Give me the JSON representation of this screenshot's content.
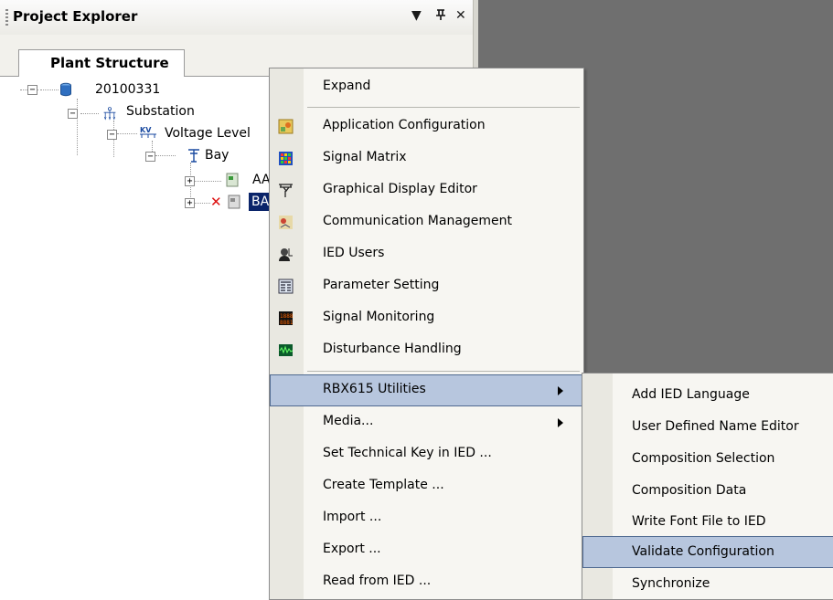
{
  "panel": {
    "title": "Project Explorer",
    "buttons": [
      "▼",
      "ᵖ",
      "✕"
    ]
  },
  "tabs": [
    {
      "label": "Plant Structure"
    }
  ],
  "tree": {
    "root": "20100331",
    "substation": "Substation",
    "voltage_level": "Voltage Level",
    "bay": "Bay",
    "ied1": "AA",
    "ied2": "BA"
  },
  "context_menu": {
    "items": [
      {
        "label": "Expand"
      },
      {
        "label": "Application Configuration",
        "icon": "application-configuration-icon"
      },
      {
        "label": "Signal Matrix",
        "icon": "signal-matrix-icon"
      },
      {
        "label": "Graphical Display Editor",
        "icon": "graphical-display-editor-icon"
      },
      {
        "label": "Communication Management",
        "icon": "communication-management-icon"
      },
      {
        "label": "IED Users",
        "icon": "ied-users-icon"
      },
      {
        "label": "Parameter Setting",
        "icon": "parameter-setting-icon"
      },
      {
        "label": "Signal Monitoring",
        "icon": "signal-monitoring-icon"
      },
      {
        "label": "Disturbance Handling",
        "icon": "disturbance-handling-icon"
      },
      {
        "label": "RBX615 Utilities"
      },
      {
        "label": "Media..."
      },
      {
        "label": "Set Technical Key in IED ..."
      },
      {
        "label": "Create Template ..."
      },
      {
        "label": "Import ..."
      },
      {
        "label": "Export ..."
      },
      {
        "label": "Read from IED ..."
      }
    ]
  },
  "submenu": {
    "items": [
      {
        "label": "Add IED Language"
      },
      {
        "label": "User Defined Name Editor"
      },
      {
        "label": "Composition Selection"
      },
      {
        "label": "Composition Data"
      },
      {
        "label": "Write Font File to IED"
      },
      {
        "label": "Validate Configuration"
      },
      {
        "label": "Synchronize"
      }
    ]
  },
  "colors": {
    "highlight": "#b7c6de",
    "highlight_border": "#4f6990",
    "selected_tree": "#0a246a",
    "right_pane": "#6f6f6f"
  }
}
